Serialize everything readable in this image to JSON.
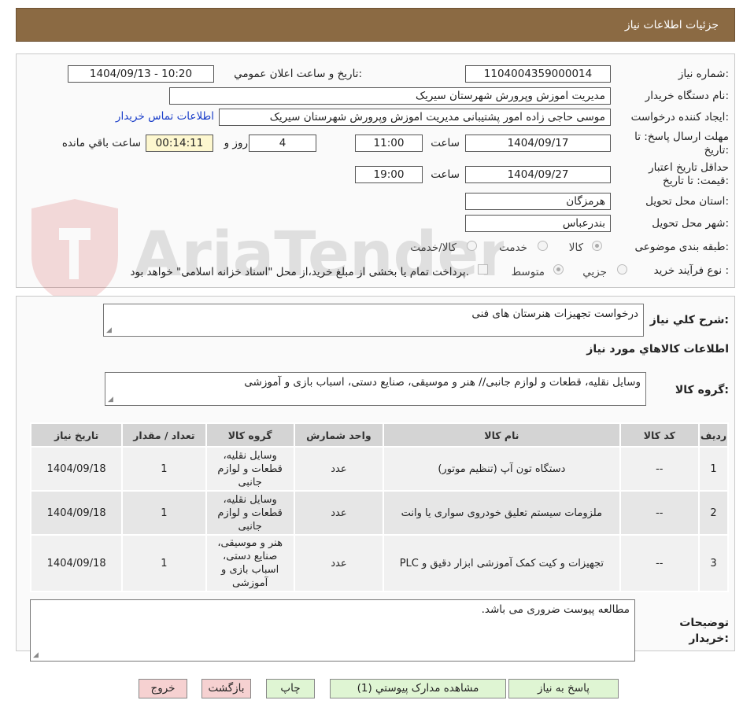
{
  "header": {
    "title": "جزئیات اطلاعات نیاز"
  },
  "watermark": {
    "text": "AriaTender.neT"
  },
  "form": {
    "need_number": {
      "label": "شماره نیاز:",
      "value": "1104004359000014"
    },
    "announce_datetime": {
      "label": "تاریخ و ساعت اعلان عمومي:",
      "value": "1404/09/13 - 10:20"
    },
    "buyer_org": {
      "label": "نام دستگاه خریدار:",
      "value": "مدیریت اموزش وپرورش شهرستان سیریک"
    },
    "requester": {
      "label": "ایجاد کننده درخواست:",
      "value": "موسی حاجی زاده امور پشتیبانی  مدیریت اموزش وپرورش شهرستان سیریک",
      "contact_link": "اطلاعات تماس خریدار"
    },
    "response_deadline": {
      "label": "مهلت ارسال پاسخ: تا تاریخ:",
      "date": "1404/09/17",
      "time_label": "ساعت",
      "time": "11:00",
      "days": "4",
      "days_label": "روز و",
      "remaining": "00:14:11",
      "remaining_label": "ساعت باقي مانده"
    },
    "price_validity": {
      "label": "حداقل تاریخ اعتبار قیمت: تا تاریخ:",
      "date": "1404/09/27",
      "time_label": "ساعت",
      "time": "19:00"
    },
    "delivery_province": {
      "label": "استان محل تحویل:",
      "value": "هرمزگان"
    },
    "delivery_city": {
      "label": "شهر محل تحویل:",
      "value": "بندرعباس"
    },
    "category": {
      "label": "طبقه بندی موضوعی:",
      "options": [
        "کالا",
        "خدمت",
        "کالا/خدمت"
      ],
      "selected": "کالا"
    },
    "purchase_type": {
      "label": "نوع فرآیند خرید :",
      "options": [
        "جزیي",
        "متوسط"
      ],
      "selected": "متوسط",
      "note": "پرداخت تمام یا بخشی از مبلغ خرید،از محل \"اسناد خزانه اسلامی\" خواهد بود."
    }
  },
  "summary": {
    "description_label": "شرح کلي نیاز:",
    "description": "درخواست تجهیزات هنرستان های فنی",
    "goods_info_title": "اطلاعات کالاهاي مورد نیاز",
    "goods_group_label": "گروه کالا:",
    "goods_group": "وسایل نقلیه، قطعات و لوازم جانبی// هنر و موسیقی، صنایع دستی، اسباب بازی و آموزشی"
  },
  "table": {
    "headers": [
      "ردیف",
      "کد کالا",
      "نام کالا",
      "واحد شمارش",
      "گروه کالا",
      "تعداد / مقدار",
      "تاریخ نیاز"
    ],
    "rows": [
      {
        "row": "1",
        "code": "--",
        "name": "دستگاه تون آپ (تنظیم موتور)",
        "unit": "عدد",
        "group": "وسایل نقلیه، قطعات و لوازم جانبی",
        "qty": "1",
        "date": "1404/09/18"
      },
      {
        "row": "2",
        "code": "--",
        "name": "ملزومات سیستم تعلیق خودروی سواری یا وانت",
        "unit": "عدد",
        "group": "وسایل نقلیه، قطعات و لوازم جانبی",
        "qty": "1",
        "date": "1404/09/18"
      },
      {
        "row": "3",
        "code": "--",
        "name": "تجهیزات و کیت کمک آموزشی ابزار دقیق و PLC",
        "unit": "عدد",
        "group": "هنر و موسیقی، صنایع دستی، اسباب بازی و آموزشی",
        "qty": "1",
        "date": "1404/09/18"
      }
    ]
  },
  "buyer_notes": {
    "label": "توضیحات خریدار:",
    "value": "مطالعه پیوست ضروری می باشد."
  },
  "buttons": {
    "reply": "پاسخ به نیاز",
    "attachments": "مشاهده مدارک پیوستي (1)",
    "print": "چاپ",
    "back": "بازگشت",
    "exit": "خروج"
  },
  "colors": {
    "header_bg": "#8b6a43",
    "link": "#1a3ec9",
    "green_button": "#dff5d3",
    "pink_button": "#f6d1d1"
  }
}
